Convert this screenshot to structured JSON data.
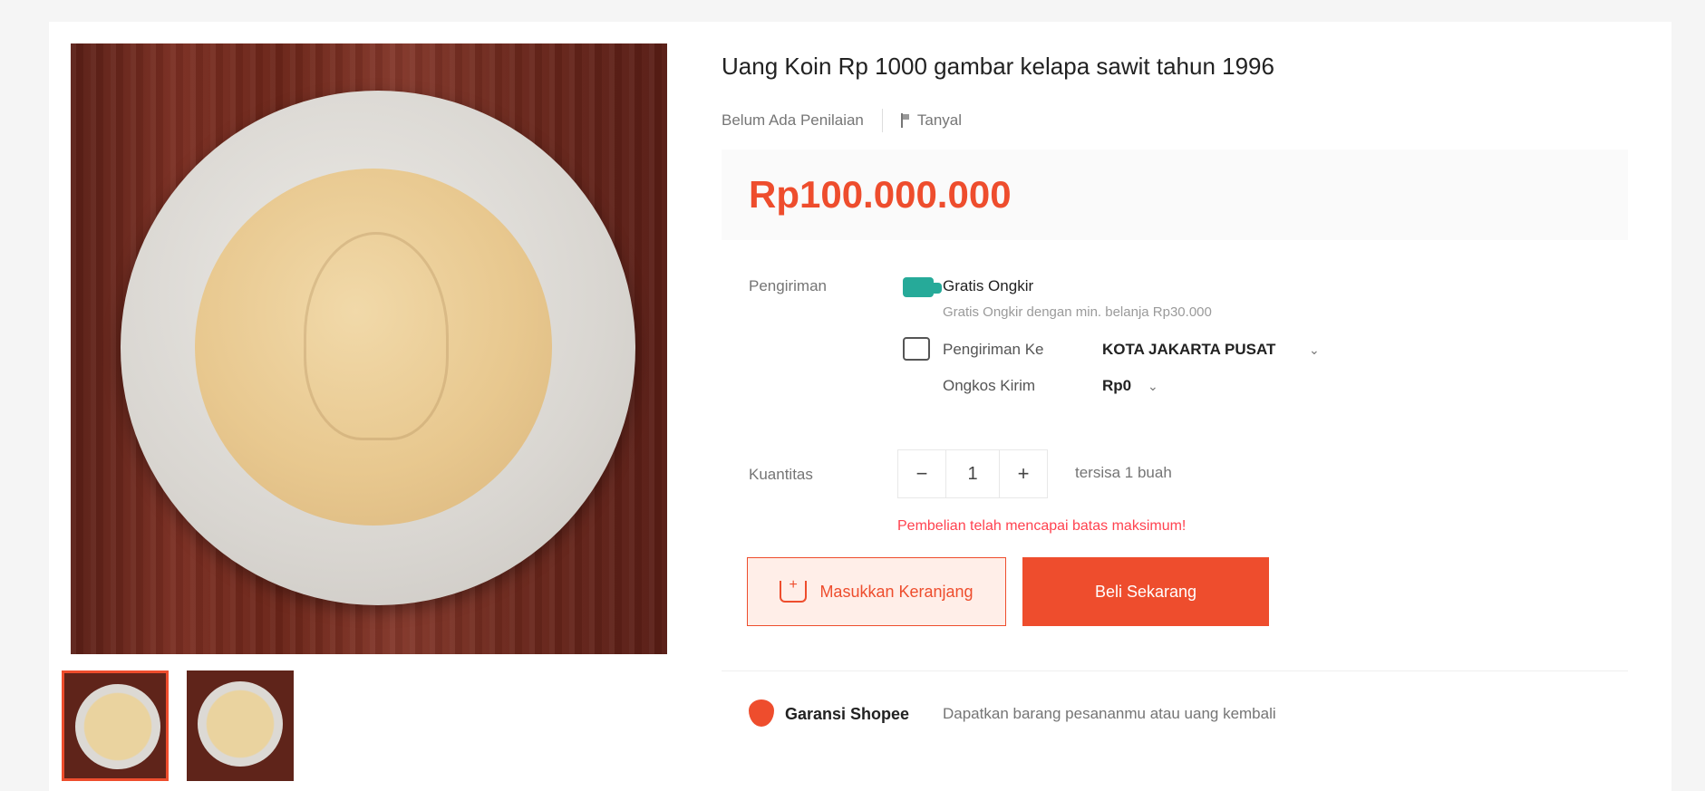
{
  "product": {
    "title": "Uang Koin Rp 1000 gambar kelapa sawit tahun 1996",
    "rating_text": "Belum Ada Penilaian",
    "report_label": "Tanyal",
    "price": "Rp100.000.000"
  },
  "shipping": {
    "label": "Pengiriman",
    "free_title": "Gratis Ongkir",
    "free_subtitle": "Gratis Ongkir dengan min. belanja Rp30.000",
    "ship_to_label": "Pengiriman Ke",
    "ship_to_value": "KOTA JAKARTA PUSAT",
    "cost_label": "Ongkos Kirim",
    "cost_value": "Rp0"
  },
  "quantity": {
    "label": "Kuantitas",
    "minus": "−",
    "value": "1",
    "plus": "+",
    "stock_text": "tersisa 1 buah",
    "warning": "Pembelian telah mencapai batas maksimum!"
  },
  "actions": {
    "add_to_cart": "Masukkan Keranjang",
    "buy_now": "Beli Sekarang"
  },
  "guarantee": {
    "title": "Garansi Shopee",
    "subtitle": "Dapatkan barang pesananmu atau uang kembali"
  },
  "colors": {
    "accent": "#ee4d2d",
    "free_shipping": "#26aa99",
    "warning": "#ff424f"
  },
  "icons": [
    "flag-icon",
    "truck-icon",
    "ship-icon",
    "chevron-down-icon",
    "cart-icon",
    "guarantee-icon"
  ]
}
